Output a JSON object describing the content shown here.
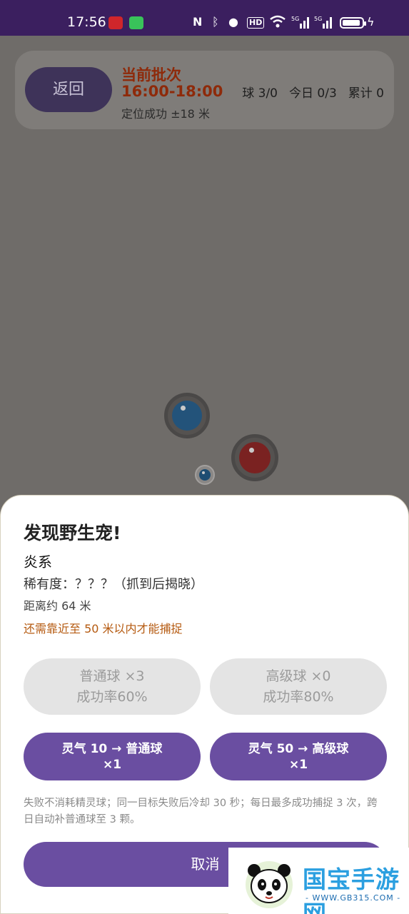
{
  "status_bar": {
    "time": "17:56",
    "icons": [
      "nfc-icon",
      "bluetooth-icon",
      "location-icon",
      "hd-icon",
      "wifi-icon",
      "signal-5g-icon",
      "signal-5g-icon",
      "battery-icon",
      "charging-icon"
    ]
  },
  "top_card": {
    "back_label": "返回",
    "batch_title": "当前批次",
    "batch_time": "16:00-18:00",
    "location_status": "定位成功 ±18 米",
    "balls": "球 3/0",
    "today": "今日 0/3",
    "total": "累计 0"
  },
  "sheet": {
    "title": "发现野生宠!",
    "element": "炎系",
    "rarity": "稀有度：？？？（抓到后揭晓）",
    "distance": "距离约 64 米",
    "hint": "还需靠近至 50 米以内才能捕捉",
    "normal_ball": {
      "name": "普通球 ×3",
      "rate": "成功率60%"
    },
    "advanced_ball": {
      "name": "高级球 ×0",
      "rate": "成功率80%"
    },
    "exchange_normal": {
      "line1": "灵气 10 → 普通球",
      "line2": "×1"
    },
    "exchange_advanced": {
      "line1": "灵气 50 → 高级球",
      "line2": "×1"
    },
    "rules": "失败不消耗精灵球；同一目标失败后冷却 30 秒；每日最多成功捕捉 3 次，跨日自动补普通球至 3 颗。",
    "cancel_label": "取消"
  },
  "watermark": {
    "brand": "国宝手游网",
    "url": "- WWW.GB315.COM -"
  },
  "colors": {
    "accent": "#6a4ea1",
    "status_bar": "#3b1f5f",
    "batch_text": "#8e2a0a",
    "hint": "#b55a10"
  }
}
